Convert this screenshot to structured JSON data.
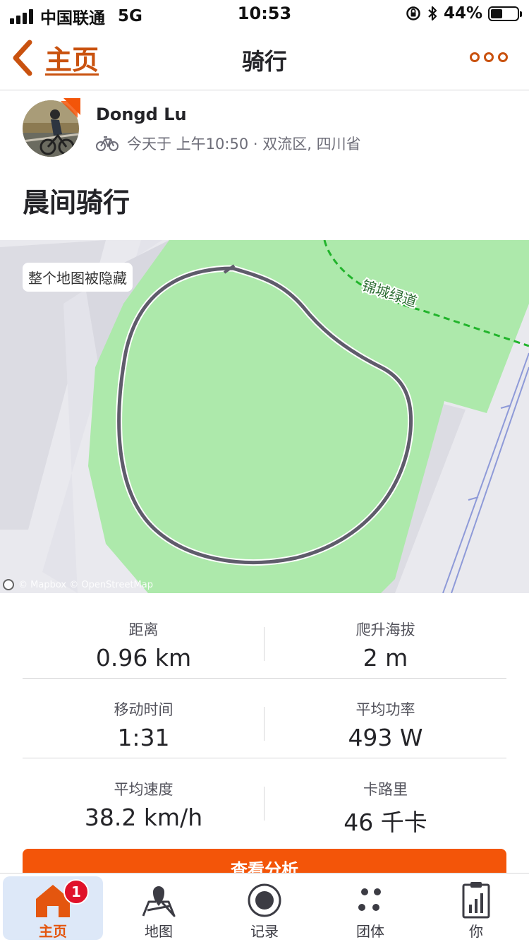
{
  "status_bar": {
    "carrier": "中国联通",
    "network": "5G",
    "time": "10:53",
    "battery": "44%",
    "battery_level": 0.44
  },
  "nav": {
    "back_label": "主页",
    "title": "骑行"
  },
  "activity": {
    "athlete_name": "Dongd Lu",
    "meta": "今天于 上午10:50 · 双流区, 四川省",
    "title": "晨间骑行"
  },
  "map": {
    "hidden_label": "整个地图被隐藏",
    "trail_label": "锦城绿道",
    "credit": "© Mapbox © OpenStreetMap"
  },
  "stats": [
    {
      "left": {
        "label": "距离",
        "value": "0.96 km"
      },
      "right": {
        "label": "爬升海拔",
        "value": "2 m"
      }
    },
    {
      "left": {
        "label": "移动时间",
        "value": "1:31"
      },
      "right": {
        "label": "平均功率",
        "value": "493 W"
      }
    },
    {
      "left": {
        "label": "平均速度",
        "value": "38.2 km/h"
      },
      "right": {
        "label": "卡路里",
        "value": "46 千卡"
      }
    }
  ],
  "analysis_button": "查看分析",
  "tabs": [
    {
      "label": "主页",
      "badge": "1"
    },
    {
      "label": "地图"
    },
    {
      "label": "记录"
    },
    {
      "label": "团体"
    },
    {
      "label": "你"
    }
  ],
  "colors": {
    "accent": "#f35509",
    "brand_dark": "#c9520f",
    "map_green": "#ade9ab",
    "route": "#5f5c6b"
  }
}
